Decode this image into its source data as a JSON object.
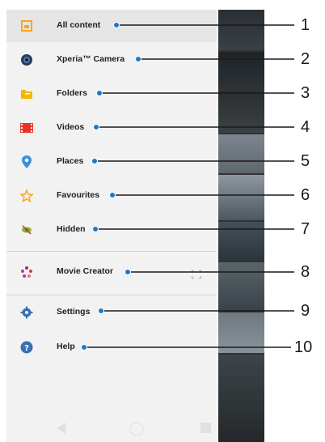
{
  "menu": {
    "items": [
      {
        "label": "All content",
        "icon": "image-icon"
      },
      {
        "label": "Xperia™ Camera",
        "icon": "camera-lens-icon"
      },
      {
        "label": "Folders",
        "icon": "folder-icon"
      },
      {
        "label": "Videos",
        "icon": "film-strip-icon"
      },
      {
        "label": "Places",
        "icon": "location-pin-icon"
      },
      {
        "label": "Favourites",
        "icon": "star-icon"
      },
      {
        "label": "Hidden",
        "icon": "hidden-eye-icon"
      },
      {
        "label": "Movie Creator",
        "icon": "movie-creator-icon"
      },
      {
        "label": "Settings",
        "icon": "gear-icon"
      },
      {
        "label": "Help",
        "icon": "help-icon"
      }
    ]
  },
  "callouts": [
    "1",
    "2",
    "3",
    "4",
    "5",
    "6",
    "7",
    "8",
    "9",
    "10"
  ],
  "colors": {
    "accent_blue": "#1e78c8",
    "callout_line": "#1a1a1a",
    "orange": "#f5a623",
    "red": "#e8332a"
  }
}
